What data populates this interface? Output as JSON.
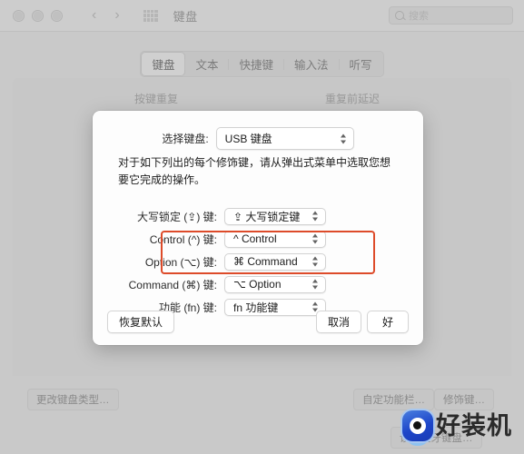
{
  "titlebar": {
    "title": "键盘",
    "traffic_lights": [
      "close",
      "minimize",
      "zoom"
    ],
    "back_glyph": "‹",
    "forward_glyph": "›",
    "grid_icon": "grid-icon"
  },
  "search": {
    "placeholder": "搜索",
    "icon": "search-icon"
  },
  "tabs": [
    {
      "label": "键盘",
      "selected": true
    },
    {
      "label": "文本",
      "selected": false
    },
    {
      "label": "快捷键",
      "selected": false
    },
    {
      "label": "输入法",
      "selected": false
    },
    {
      "label": "听写",
      "selected": false
    }
  ],
  "background": {
    "key_repeat_label": "按键重复",
    "delay_until_repeat_label": "重复前延迟",
    "buttons": {
      "change_keyboard_type": "更改键盘类型…",
      "customize_touch_bar": "自定功能栏…",
      "modifier_keys": "修饰键…",
      "setup_bluetooth_keyboard": "设置蓝牙键盘…"
    }
  },
  "dialog": {
    "select_keyboard_label": "选择键盘:",
    "select_keyboard_value": "USB 键盘",
    "description": "对于如下列出的每个修饰键，请从弹出式菜单中选取您想要它完成的操作。",
    "modifiers": [
      {
        "label": "大写锁定 (⇪) 键:",
        "value": "⇪ 大写锁定键",
        "highlighted": false
      },
      {
        "label": "Control (^) 键:",
        "value": "^ Control",
        "highlighted": false
      },
      {
        "label": "Option (⌥) 键:",
        "value": "⌘ Command",
        "highlighted": true
      },
      {
        "label": "Command (⌘) 键:",
        "value": "⌥ Option",
        "highlighted": true
      },
      {
        "label": "功能 (fn) 键:",
        "value": "fn 功能键",
        "highlighted": false
      }
    ],
    "buttons": {
      "restore_defaults": "恢复默认",
      "cancel": "取消",
      "ok": "好"
    }
  },
  "watermark": {
    "text": "好装机",
    "logo": "eye-logo"
  },
  "colors": {
    "highlight_border": "#dd4b2a",
    "window_background": "#c9c9c9",
    "dialog_background": "#fdfdfd",
    "logo_blue": "#1d46c9"
  }
}
